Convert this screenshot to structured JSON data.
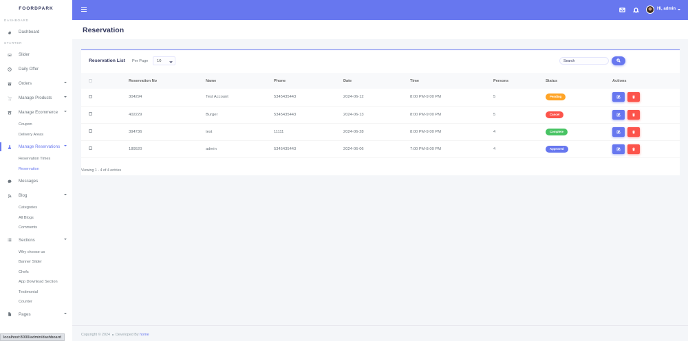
{
  "brand": "FOORDPARK",
  "sidebar": {
    "header_dashboard": "DASHBOARD",
    "header_starter": "STARTER",
    "items": {
      "dashboard": "Dashboard",
      "slider": "Slider",
      "daily_offer": "Daily Offer",
      "orders": "Orders",
      "manage_products": "Manage Products",
      "manage_ecommerce": "Manage Ecommerce",
      "coupon": "Coupon",
      "delivery_areas": "Delivery Areas",
      "manage_reservations": "Manage Reservations",
      "reservation_times": "Reservation Times",
      "reservation": "Reservation",
      "messages": "Messages",
      "blog": "Blog",
      "categories": "Categories",
      "all_blogs": "All Blogs",
      "comments": "Comments",
      "sections": "Sections",
      "why_choose_us": "Why choose us",
      "banner_slider": "Banner Slider",
      "chefs": "Chefs",
      "app_download_section": "App Download Section",
      "testimonial": "Testimonial",
      "counter": "Counter",
      "pages": "Pages"
    }
  },
  "topbar": {
    "user_greeting": "Hi, admin"
  },
  "page_title": "Reservation",
  "card": {
    "title": "Reservation List",
    "per_page_label": "Per Page",
    "per_page_value": "10",
    "search_placeholder": "Search",
    "viewing": "Viewing 1 - 4 of 4 entries"
  },
  "table": {
    "headers": [
      "Reservation No",
      "Name",
      "Phone",
      "Date",
      "Time",
      "Persons",
      "Status",
      "Actions"
    ],
    "rows": [
      {
        "no": "304294",
        "name": "Test Account",
        "phone": "5345435443",
        "date": "2024-06-12",
        "time": "8:00 PM-9:00 PM",
        "persons": "5",
        "status": "Pending"
      },
      {
        "no": "402229",
        "name": "Burger",
        "phone": "5345435443",
        "date": "2024-06-13",
        "time": "8:00 PM-9:00 PM",
        "persons": "5",
        "status": "Cancel"
      },
      {
        "no": "394736",
        "name": "test",
        "phone": "11111",
        "date": "2024-06-28",
        "time": "8:00 PM-9:00 PM",
        "persons": "4",
        "status": "Complete"
      },
      {
        "no": "189520",
        "name": "admin",
        "phone": "5345435443",
        "date": "2024-06-06",
        "time": "7:00 PM-8:00 PM",
        "persons": "4",
        "status": "Approved"
      }
    ]
  },
  "status_colors": {
    "Pending": "#ffa426",
    "Cancel": "#fc544b",
    "Complete": "#47c363",
    "Approved": "#6777ef"
  },
  "footer": {
    "copyright": "Copyright © 2024",
    "developed_by": "Developed By",
    "link": "home"
  },
  "browser_status_url": "localhost:8000/admin/dashboard"
}
